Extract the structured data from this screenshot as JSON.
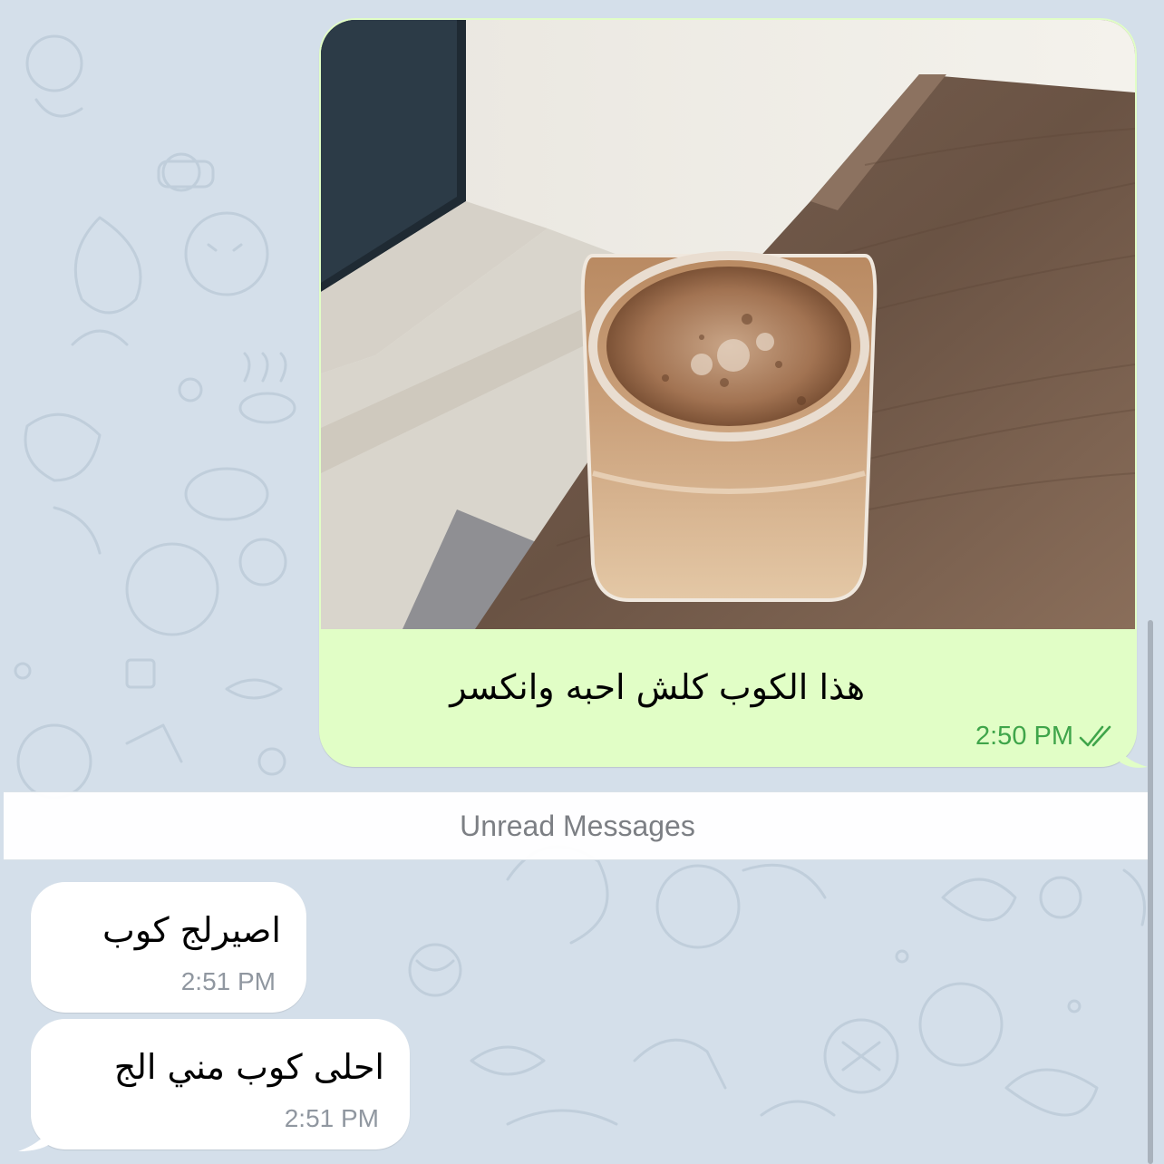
{
  "chat": {
    "outgoing": {
      "photo_alt": "Iced coffee in a glass jar on a wooden table",
      "text": "هذا الكوب كلش احبه وانكسر",
      "time": "2:50 PM",
      "status_icon": "double-check-icon",
      "accent_color": "#3fa54a",
      "bubble_color": "#e1fec6"
    },
    "unread_divider": "Unread Messages",
    "incoming": [
      {
        "text": "اصيرلج كوب",
        "time": "2:51 PM"
      },
      {
        "text": "احلى كوب مني الج",
        "time": "2:51 PM"
      }
    ],
    "wallpaper_color": "#d4dfea"
  }
}
